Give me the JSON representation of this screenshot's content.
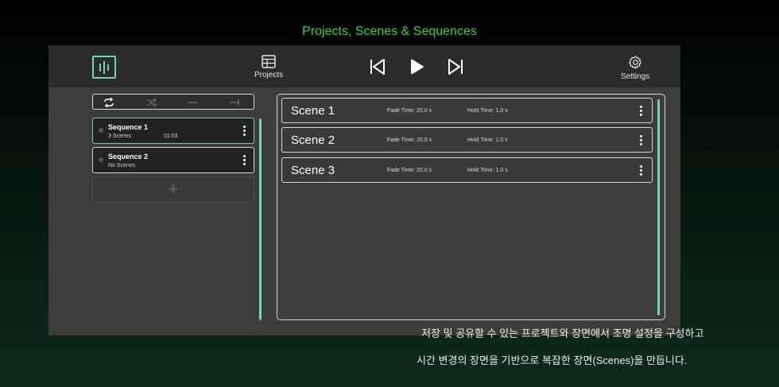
{
  "page_title": "Projects, Scenes & Sequences",
  "colors": {
    "accent": "#6fd6b4",
    "title_green": "#3cd23c",
    "app_bg": "#3c3c3c",
    "topbar_bg": "#2b2b2b"
  },
  "topbar": {
    "logo_icon": "equalizer-logo-icon",
    "projects_label": "Projects",
    "projects_icon": "table-grid-icon",
    "settings_label": "Settings",
    "settings_icon": "gear-icon",
    "transport": [
      "skip-previous-icon",
      "play-icon",
      "skip-next-icon"
    ]
  },
  "mode_bar": [
    "loop-icon",
    "shuffle-icon",
    "dash-icon",
    "stop-end-icon"
  ],
  "sequences": [
    {
      "name": "Sequence 1",
      "subtitle": "3 Scenes",
      "duration": "01:03",
      "active": true
    },
    {
      "name": "Sequence 2",
      "subtitle": "No Scenes",
      "duration": "",
      "active": false
    }
  ],
  "add_sequence_label": "+",
  "scenes": [
    {
      "name": "Scene 1",
      "fade": "Fade Time: 20.0 s",
      "hold": "Hold Time: 1.0 s"
    },
    {
      "name": "Scene 2",
      "fade": "Fade Time: 20.0 s",
      "hold": "Hold Time: 1.0 s"
    },
    {
      "name": "Scene 3",
      "fade": "Fade Time: 20.0 s",
      "hold": "Hold Time: 1.0 s"
    }
  ],
  "caption": {
    "line1": "저장 및 공유할 수 있는 프로젝트와 장면에서 조명 설정을 구성하고",
    "line2": "시간 변경의 장면을 기반으로 복잡한 장면(Scenes)을 만듭니다."
  }
}
